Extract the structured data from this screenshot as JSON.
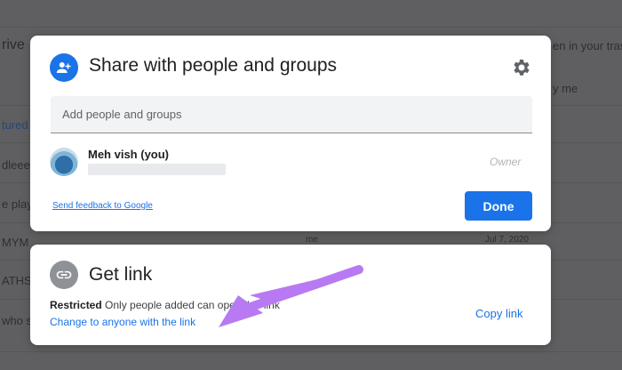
{
  "background": {
    "fragments": [
      "rive",
      "tured",
      "dleee",
      "e play",
      "MYM",
      "ATHS T",
      "who s",
      "en in your tras",
      "y me",
      "me",
      "Jul 7, 2020"
    ]
  },
  "share_dialog": {
    "title": "Share with people and groups",
    "add_placeholder": "Add people and groups",
    "user": {
      "name": "Meh vish (you)",
      "role": "Owner"
    },
    "feedback_link": "Send feedback to Google",
    "done_button": "Done"
  },
  "get_link": {
    "title": "Get link",
    "restriction": "Restricted",
    "description": "Only people added can open this link",
    "change_link": "Change to anyone with the link",
    "copy_link": "Copy link"
  },
  "icons": {
    "share": "person-add-icon",
    "settings": "gear-icon",
    "link": "link-icon",
    "annotation": "arrow-annotation"
  },
  "colors": {
    "accent": "#1a73e8",
    "annotation_arrow": "#b87af2"
  }
}
